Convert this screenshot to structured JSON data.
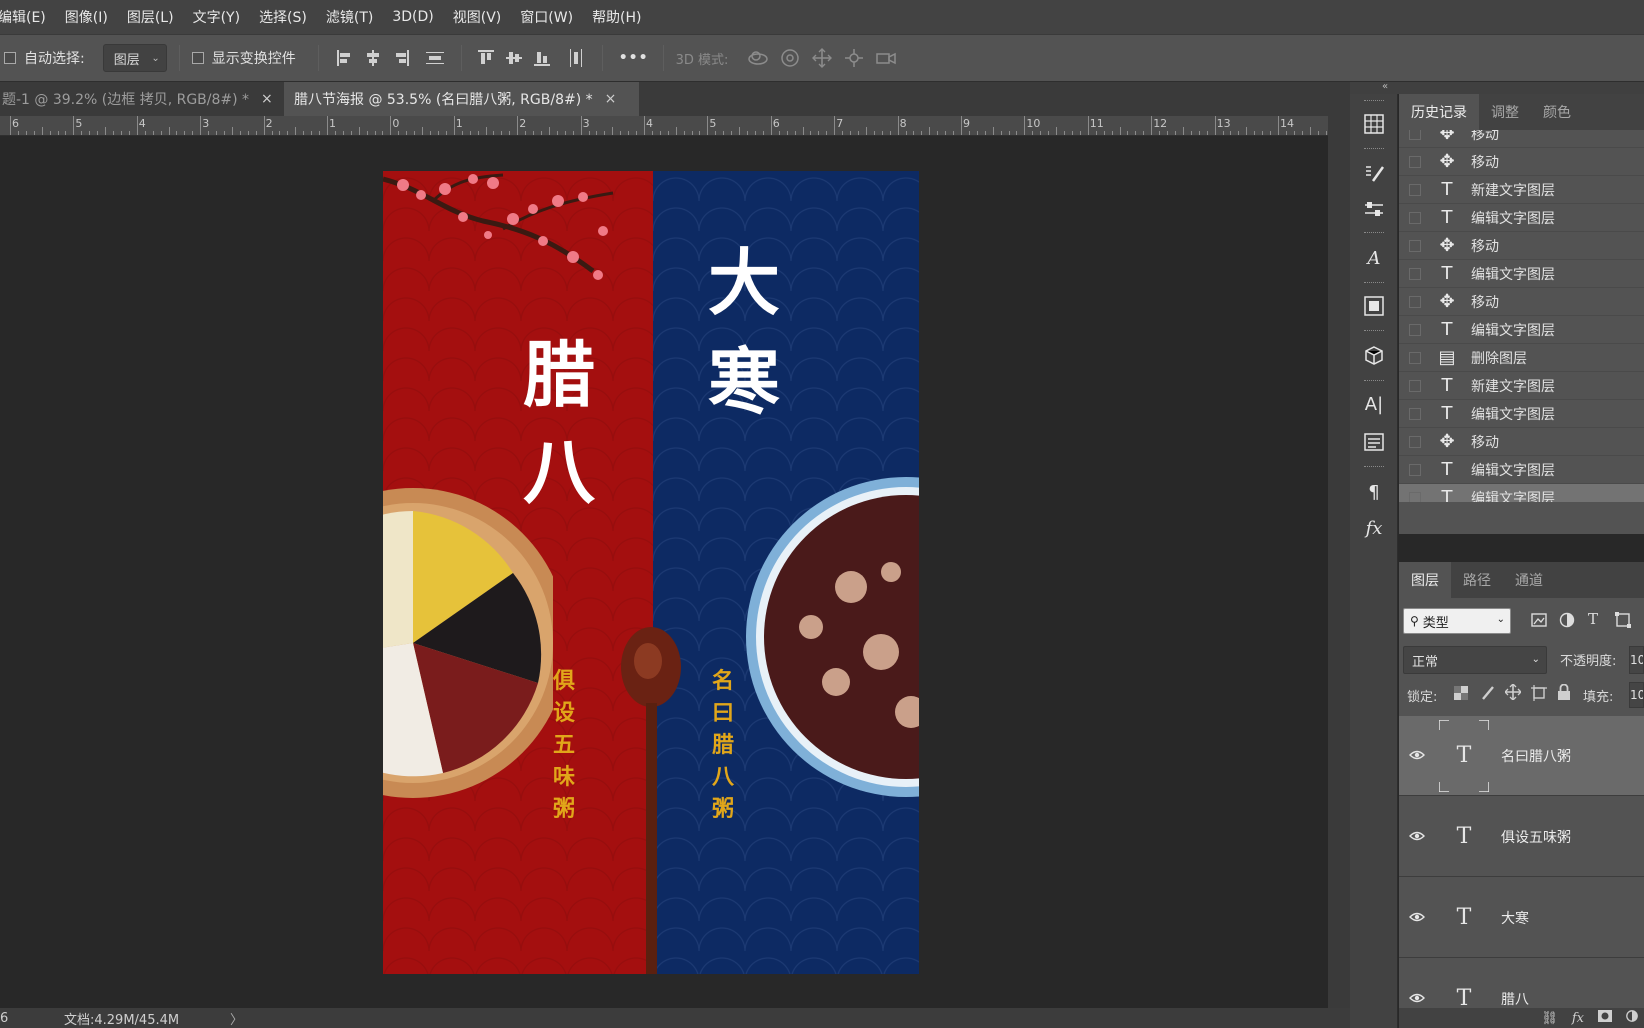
{
  "menubar": [
    "编辑(E)",
    "图像(I)",
    "图层(L)",
    "文字(Y)",
    "选择(S)",
    "滤镜(T)",
    "3D(D)",
    "视图(V)",
    "窗口(W)",
    "帮助(H)"
  ],
  "options": {
    "auto_select_label": "自动选择:",
    "auto_select_value": "图层",
    "show_transform_label": "显示变换控件",
    "more_label": "•••",
    "mode3d_label": "3D 模式:"
  },
  "tabs": [
    {
      "label": "题-1 @ 39.2% (边框 拷贝, RGB/8#) *",
      "close": "×",
      "active": false
    },
    {
      "label": "腊八节海报 @ 53.5% (名曰腊八粥, RGB/8#) *",
      "close": "×",
      "active": true
    }
  ],
  "ruler_labels": [
    "6",
    "5",
    "4",
    "3",
    "2",
    "1",
    "0",
    "1",
    "2",
    "3",
    "4",
    "5",
    "6",
    "7",
    "8",
    "9",
    "10",
    "11",
    "12",
    "13",
    "14"
  ],
  "poster": {
    "left_title_1": "腊",
    "left_title_2": "八",
    "right_title_1": "大",
    "right_title_2": "寒",
    "left_verse": "俱设五味粥",
    "right_verse": "名曰腊八粥",
    "colors": {
      "red": "#a40f0f",
      "blue": "#0d2a63",
      "gold": "#e1a61a"
    }
  },
  "status": {
    "zoom": "6",
    "doc": "文档:4.29M/45.4M",
    "arrow": "〉"
  },
  "collapse_glyph": "«",
  "history": {
    "tabs": [
      "历史记录",
      "调整",
      "颜色"
    ],
    "items": [
      {
        "icon": "move-icon",
        "glyph": "✥",
        "label": "移动"
      },
      {
        "icon": "move-icon",
        "glyph": "✥",
        "label": "移动"
      },
      {
        "icon": "text-icon",
        "glyph": "T",
        "label": "新建文字图层"
      },
      {
        "icon": "text-icon",
        "glyph": "T",
        "label": "编辑文字图层"
      },
      {
        "icon": "move-icon",
        "glyph": "✥",
        "label": "移动"
      },
      {
        "icon": "text-icon",
        "glyph": "T",
        "label": "编辑文字图层"
      },
      {
        "icon": "move-icon",
        "glyph": "✥",
        "label": "移动"
      },
      {
        "icon": "text-icon",
        "glyph": "T",
        "label": "编辑文字图层"
      },
      {
        "icon": "delete-layer-icon",
        "glyph": "▤",
        "label": "删除图层"
      },
      {
        "icon": "text-icon",
        "glyph": "T",
        "label": "新建文字图层"
      },
      {
        "icon": "text-icon",
        "glyph": "T",
        "label": "编辑文字图层"
      },
      {
        "icon": "move-icon",
        "glyph": "✥",
        "label": "移动"
      },
      {
        "icon": "text-icon",
        "glyph": "T",
        "label": "编辑文字图层"
      },
      {
        "icon": "text-icon",
        "glyph": "T",
        "label": "编辑文字图层"
      }
    ]
  },
  "layers": {
    "tabs": [
      "图层",
      "路径",
      "通道"
    ],
    "filter_label": "类型",
    "blend_mode": "正常",
    "opacity_label": "不透明度:",
    "opacity_value": "10",
    "lock_label": "锁定:",
    "fill_label": "填充:",
    "fill_value": "10",
    "items": [
      {
        "name": "名曰腊八粥",
        "selected": true
      },
      {
        "name": "俱设五味粥",
        "selected": false
      },
      {
        "name": "大寒",
        "selected": false
      },
      {
        "name": "腊八",
        "selected": false
      }
    ],
    "fx_label": "fx"
  }
}
